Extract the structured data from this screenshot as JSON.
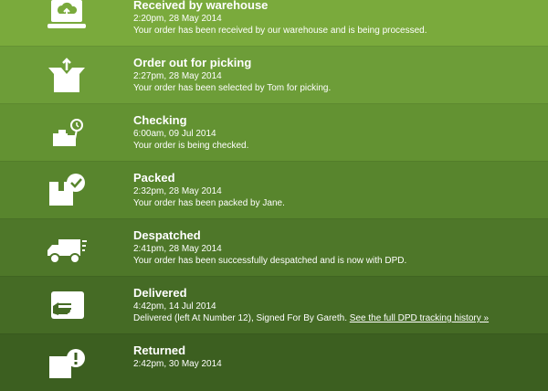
{
  "colors": {
    "row_backgrounds": [
      "#7aaa3c",
      "#6d9d38",
      "#639232",
      "#58852d",
      "#4e7729",
      "#456b25",
      "#3c5f20"
    ],
    "text": "#ffffff"
  },
  "steps": [
    {
      "icon": "laptop-upload-icon",
      "title": "Received by warehouse",
      "time": "2:20pm, 28 May 2014",
      "description": "Your order has been received by our warehouse and is being processed."
    },
    {
      "icon": "open-box-icon",
      "title": "Order out for picking",
      "time": "2:27pm, 28 May 2014",
      "description": "Your order has been selected by Tom for picking."
    },
    {
      "icon": "boxes-clock-icon",
      "title": "Checking",
      "time": "6:00am, 09 Jul 2014",
      "description": "Your order is being checked."
    },
    {
      "icon": "box-checkmark-icon",
      "title": "Packed",
      "time": "2:32pm, 28 May 2014",
      "description": "Your order has been packed by Jane."
    },
    {
      "icon": "delivery-truck-icon",
      "title": "Despatched",
      "time": "2:41pm, 28 May 2014",
      "description": "Your order has been successfully despatched and is now with DPD."
    },
    {
      "icon": "hand-package-icon",
      "title": "Delivered",
      "time": "4:42pm, 14 Jul 2014",
      "description": "Delivered (left At Number 12), Signed For By Gareth.",
      "link": "See the full DPD tracking history »"
    },
    {
      "icon": "box-alert-icon",
      "title": "Returned",
      "time": "2:42pm, 30 May 2014",
      "description": ""
    }
  ]
}
